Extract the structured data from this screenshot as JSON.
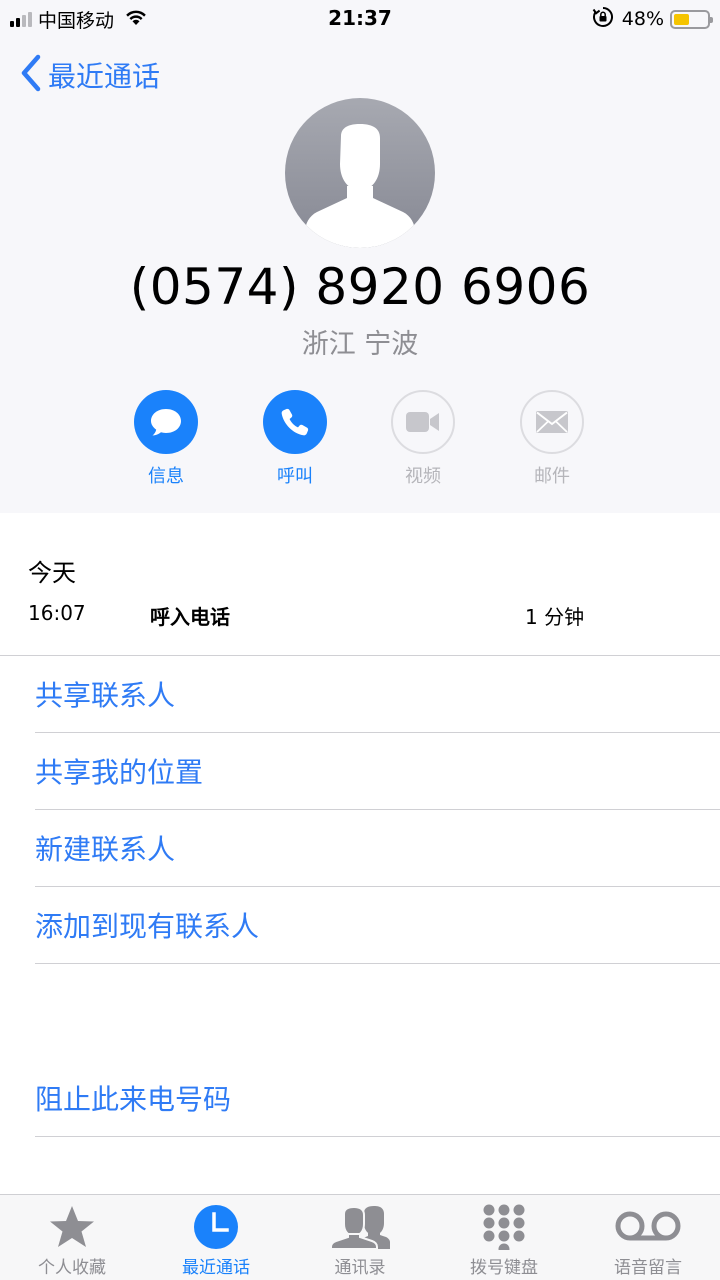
{
  "status_bar": {
    "carrier": "中国移动",
    "time": "21:37",
    "battery_percent": "48%",
    "battery_level": 0.48,
    "battery_color": "#f5c400"
  },
  "nav": {
    "back_label": "最近通话"
  },
  "contact": {
    "phone_number": "(0574) 8920 6906",
    "location": "浙江 宁波"
  },
  "actions": [
    {
      "label": "信息",
      "icon": "message-icon",
      "enabled": true
    },
    {
      "label": "呼叫",
      "icon": "phone-icon",
      "enabled": true
    },
    {
      "label": "视频",
      "icon": "video-icon",
      "enabled": false
    },
    {
      "label": "邮件",
      "icon": "mail-icon",
      "enabled": false
    }
  ],
  "call_log": {
    "day": "今天",
    "entries": [
      {
        "time": "16:07",
        "type": "呼入电话",
        "duration": "1 分钟"
      }
    ]
  },
  "options": [
    {
      "label": "共享联系人"
    },
    {
      "label": "共享我的位置"
    },
    {
      "label": "新建联系人"
    },
    {
      "label": "添加到现有联系人"
    }
  ],
  "block_option": {
    "label": "阻止此来电号码"
  },
  "tab_bar": {
    "tabs": [
      {
        "label": "个人收藏",
        "icon": "star-icon",
        "active": false
      },
      {
        "label": "最近通话",
        "icon": "clock-icon",
        "active": true
      },
      {
        "label": "通讯录",
        "icon": "contacts-icon",
        "active": false
      },
      {
        "label": "拨号键盘",
        "icon": "keypad-icon",
        "active": false
      },
      {
        "label": "语音留言",
        "icon": "voicemail-icon",
        "active": false
      }
    ]
  },
  "colors": {
    "accent": "#1a82fb",
    "link": "#2f7bf5",
    "inactive": "#8e8e93"
  }
}
